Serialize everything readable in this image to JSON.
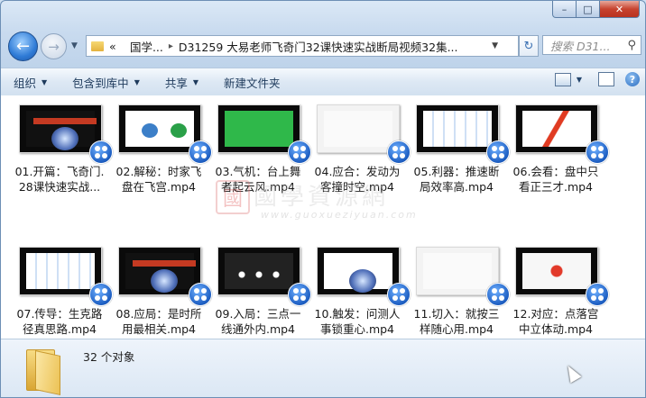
{
  "window": {
    "caption_buttons": {
      "minimize": "–",
      "maximize": "□",
      "close": "✕"
    }
  },
  "nav": {
    "back_icon": "back-arrow-icon",
    "forward_icon": "forward-arrow-icon",
    "breadcrumb": [
      "«",
      "国学...",
      "D31259 大易老师飞奇门32课快速实战断局视频32集..."
    ],
    "search_placeholder": "搜索 D31..."
  },
  "toolbar": {
    "items": [
      {
        "label": "组织",
        "has_dropdown": true
      },
      {
        "label": "包含到库中",
        "has_dropdown": true
      },
      {
        "label": "共享",
        "has_dropdown": true
      },
      {
        "label": "新建文件夹",
        "has_dropdown": false
      }
    ]
  },
  "files": [
    {
      "name": "01.开篇：飞奇门.\n28课快速实战...",
      "thumb": "title"
    },
    {
      "name": "02.解秘：时家飞\n盘在飞宫.mp4",
      "thumb": "diagram"
    },
    {
      "name": "03.气机：台上舞\n者起云风.mp4",
      "thumb": "green"
    },
    {
      "name": "04.应合：发动为\n客撞时空.mp4",
      "thumb": "light"
    },
    {
      "name": "05.利器：推速断\n局效率高.mp4",
      "thumb": "grid"
    },
    {
      "name": "06.会看：盘中只\n看正三才.mp4",
      "thumb": "red"
    },
    {
      "name": "07.传导：生克路\n径真思路.mp4",
      "thumb": "grid"
    },
    {
      "name": "08.应局：是时所\n用最相关.mp4",
      "thumb": "title"
    },
    {
      "name": "09.入局：三点一\n线通外内.mp4",
      "thumb": "dots"
    },
    {
      "name": "10.触发：问测人\n事锁重心.mp4",
      "thumb": "blob"
    },
    {
      "name": "11.切入：就按三\n样随心用.mp4",
      "thumb": "light"
    },
    {
      "name": "12.对应：点落宫\n中立体动.mp4",
      "thumb": "pin"
    }
  ],
  "watermark": {
    "seal": "國",
    "text": "國學資源網",
    "url": "www.guoxueziyuan.com"
  },
  "details": {
    "count_text": "32 个对象"
  }
}
